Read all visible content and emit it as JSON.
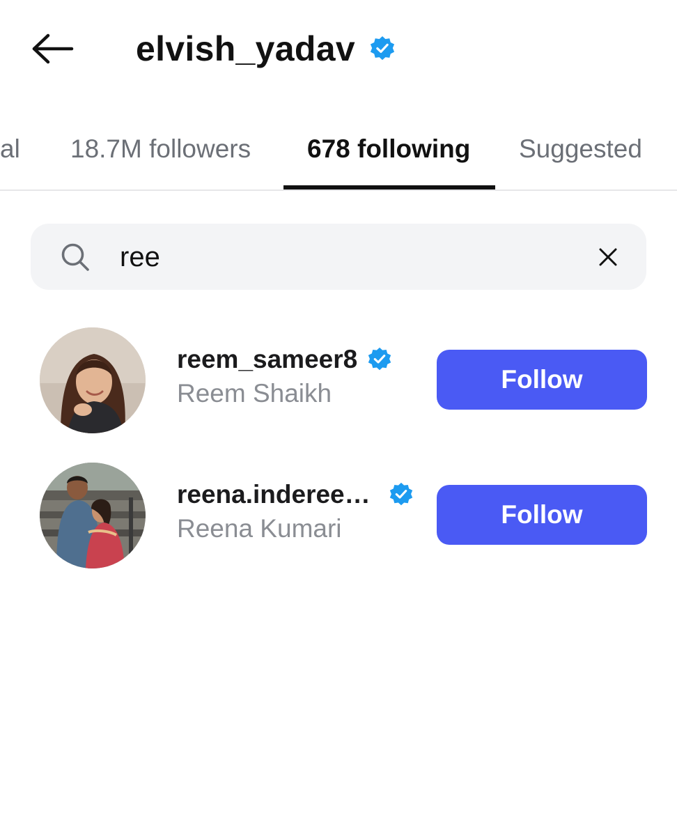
{
  "header": {
    "title": "elvish_yadav",
    "back_icon": "arrow-left-icon",
    "verified_icon": "verified-badge-icon"
  },
  "tabs": [
    {
      "label": "al",
      "active": false
    },
    {
      "label": "18.7M followers",
      "active": false
    },
    {
      "label": "678 following",
      "active": true
    },
    {
      "label": "Suggested",
      "active": false
    }
  ],
  "search": {
    "value": "ree",
    "icon": "search-icon",
    "clear_icon": "close-icon"
  },
  "results": [
    {
      "username": "reem_sameer8",
      "full_name": "Reem Shaikh",
      "verified": true,
      "button_label": "Follow"
    },
    {
      "username": "reena.inderee…",
      "full_name": "Reena Kumari",
      "verified": true,
      "button_label": "Follow"
    }
  ],
  "colors": {
    "accent": "#4a5af4",
    "verified": "#1d9bf0",
    "text_primary": "#111111",
    "text_secondary": "#8a8d93",
    "search_bg": "#f3f4f6"
  }
}
